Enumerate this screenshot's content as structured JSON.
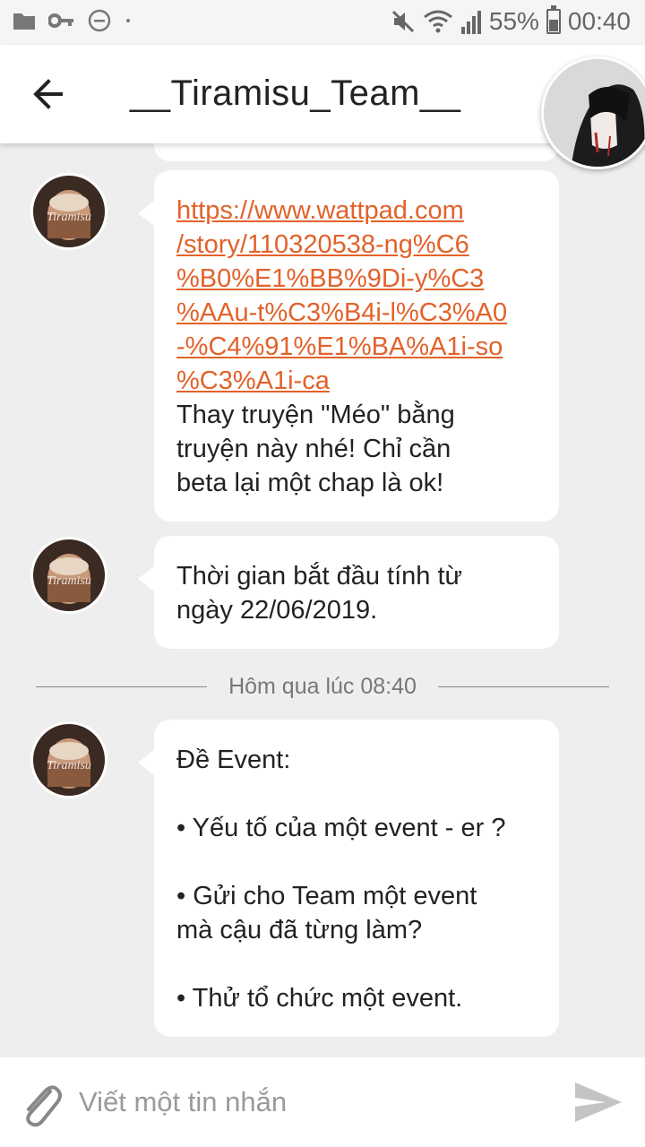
{
  "status_bar": {
    "battery": "55%",
    "time": "00:40",
    "icons": [
      "folder-icon",
      "key-icon",
      "do-not-disturb-icon",
      "dot-icon",
      "mute-icon",
      "wifi-icon",
      "signal-icon",
      "battery-icon"
    ]
  },
  "header": {
    "title": "__Tiramisu_Team__"
  },
  "messages": [
    {
      "link": "https://www.wattpad.com/story/110320538-ng%C6%B0%E1%BB%9Di-y%C3%AAu-t%C3%B4i-l%C3%A0-%C4%91%E1%BA%A1i-so%C3%A1i-ca",
      "link_lines": [
        "https://www.wattpad.com",
        "/story/110320538-ng%C6",
        "%B0%E1%BB%9Di-y%C3",
        "%AAu-t%C3%B4i-l%C3%A0",
        "-%C4%91%E1%BA%A1i-so",
        "%C3%A1i-ca"
      ],
      "text_lines": [
        "Thay truyện \"Méo\" bằng",
        "truyện này nhé! Chỉ cần",
        "beta lại một chap là ok!"
      ]
    },
    {
      "text_lines": [
        "Thời gian bắt đầu tính từ",
        "ngày 22/06/2019."
      ]
    },
    {
      "title": "Đề Event:",
      "items": [
        "• Yếu tố của một event - er ?",
        "• Gửi cho Team một event",
        "mà cậu đã từng làm?",
        "• Thử tổ chức một event."
      ]
    }
  ],
  "separator": {
    "text": "Hôm qua lúc 08:40"
  },
  "input": {
    "placeholder": "Viết một tin nhắn"
  },
  "colors": {
    "link": "#e2622b",
    "background": "#eeeeee",
    "bubble": "#ffffff"
  }
}
